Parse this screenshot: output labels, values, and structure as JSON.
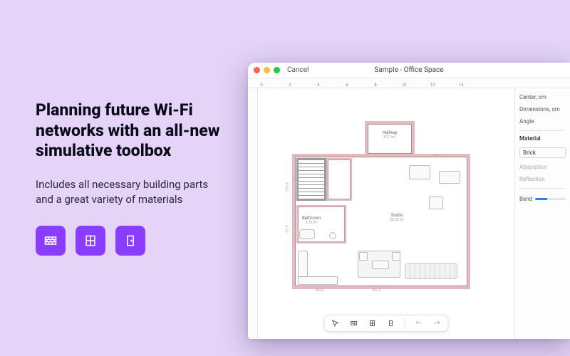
{
  "headline": "Planning future Wi-Fi networks with an all-new simulative toolbox",
  "subhead": "Includes all necessary building parts and a great variety of materials",
  "icons": [
    "wall-icon",
    "window-icon",
    "door-icon"
  ],
  "window": {
    "cancel": "Cancel",
    "title": "Sample - Office Space",
    "ruler_h": [
      "0",
      "2",
      "4",
      "6",
      "8",
      "10",
      "12",
      "14"
    ],
    "rooms": {
      "hallway": {
        "name": "Hallway",
        "area": "8.27 m²"
      },
      "bathroom": {
        "name": "Bathroom",
        "area": "5.73 m²"
      },
      "studio": {
        "name": "Studio",
        "area": "56.20 m²"
      }
    },
    "plan_dimension_labels": [
      "296.0",
      "197.0",
      "462.0",
      "369.0",
      "303.0"
    ],
    "properties": {
      "center_label": "Center, cm",
      "dimensions_label": "Dimensions, cm",
      "angle_label": "Angle",
      "material_label": "Material",
      "material_value": "Brick",
      "absorption_label": "Absorption",
      "reflection_label": "Reflection",
      "bend_label": "Bend"
    },
    "toolbar": {
      "tools": [
        "pointer-icon",
        "wall-tool-icon",
        "window-tool-icon",
        "door-tool-icon"
      ],
      "history": [
        "undo-icon",
        "redo-icon"
      ]
    }
  }
}
